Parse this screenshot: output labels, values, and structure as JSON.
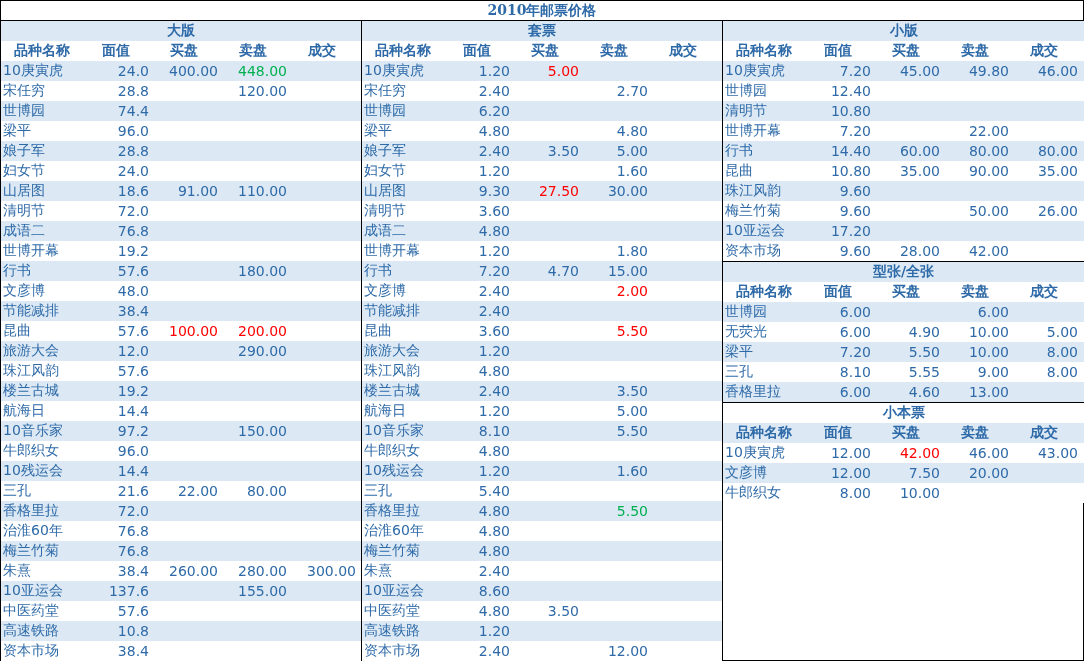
{
  "title": "2010年邮票价格",
  "panels": [
    {
      "sections": [
        {
          "title": "大版",
          "columns": [
            "品种名称",
            "面值",
            "买盘",
            "卖盘",
            "成交"
          ],
          "rows": [
            {
              "name": "10庚寅虎",
              "face": "24.0",
              "bid": "400.00",
              "ask": {
                "text": "448.00",
                "color": "#00b050"
              }
            },
            {
              "name": "宋任穷",
              "face": "28.8",
              "ask": "120.00"
            },
            {
              "name": "世博园",
              "face": "74.4"
            },
            {
              "name": "梁平",
              "face": "96.0"
            },
            {
              "name": "娘子军",
              "face": "28.8"
            },
            {
              "name": "妇女节",
              "face": "24.0"
            },
            {
              "name": "山居图",
              "face": "18.6",
              "bid": "91.00",
              "ask": "110.00"
            },
            {
              "name": "清明节",
              "face": "72.0"
            },
            {
              "name": "成语二",
              "face": "76.8"
            },
            {
              "name": "世博开幕",
              "face": "19.2"
            },
            {
              "name": "行书",
              "face": "57.6",
              "ask": "180.00"
            },
            {
              "name": "文彦博",
              "face": "48.0"
            },
            {
              "name": "节能减排",
              "face": "38.4"
            },
            {
              "name": "昆曲",
              "face": "57.6",
              "bid": {
                "text": "100.00",
                "color": "#ff0000"
              },
              "ask": {
                "text": "200.00",
                "color": "#ff0000"
              }
            },
            {
              "name": "旅游大会",
              "face": "12.0",
              "ask": "290.00"
            },
            {
              "name": "珠江风韵",
              "face": "57.6"
            },
            {
              "name": "楼兰古城",
              "face": "19.2"
            },
            {
              "name": "航海日",
              "face": "14.4"
            },
            {
              "name": "10音乐家",
              "face": "97.2",
              "ask": "150.00"
            },
            {
              "name": "牛郎织女",
              "face": "96.0"
            },
            {
              "name": "10残运会",
              "face": "14.4"
            },
            {
              "name": "三孔",
              "face": "21.6",
              "bid": "22.00",
              "ask": "80.00"
            },
            {
              "name": "香格里拉",
              "face": "72.0"
            },
            {
              "name": "治淮60年",
              "face": "76.8"
            },
            {
              "name": "梅兰竹菊",
              "face": "76.8"
            },
            {
              "name": "朱熹",
              "face": "38.4",
              "bid": "260.00",
              "ask": "280.00",
              "deal": "300.00"
            },
            {
              "name": "10亚运会",
              "face": "137.6",
              "ask": "155.00"
            },
            {
              "name": "中医药堂",
              "face": "57.6"
            },
            {
              "name": "高速铁路",
              "face": "10.8"
            },
            {
              "name": "资本市场",
              "face": "38.4"
            }
          ]
        }
      ]
    },
    {
      "sections": [
        {
          "title": "套票",
          "columns": [
            "品种名称",
            "面值",
            "买盘",
            "卖盘",
            "成交"
          ],
          "rows": [
            {
              "name": "10庚寅虎",
              "face": "1.20",
              "bid": {
                "text": "5.00",
                "color": "#ff0000"
              }
            },
            {
              "name": "宋任穷",
              "face": "2.40",
              "ask": "2.70"
            },
            {
              "name": "世博园",
              "face": "6.20"
            },
            {
              "name": "梁平",
              "face": "4.80",
              "ask": "4.80"
            },
            {
              "name": "娘子军",
              "face": "2.40",
              "bid": "3.50",
              "ask": "5.00"
            },
            {
              "name": "妇女节",
              "face": "1.20",
              "ask": "1.60"
            },
            {
              "name": "山居图",
              "face": "9.30",
              "bid": {
                "text": "27.50",
                "color": "#ff0000"
              },
              "ask": "30.00"
            },
            {
              "name": "清明节",
              "face": "3.60"
            },
            {
              "name": "成语二",
              "face": "4.80"
            },
            {
              "name": "世博开幕",
              "face": "1.20",
              "ask": "1.80"
            },
            {
              "name": "行书",
              "face": "7.20",
              "bid": "4.70",
              "ask": "15.00"
            },
            {
              "name": "文彦博",
              "face": "2.40",
              "ask": {
                "text": "2.00",
                "color": "#ff0000"
              }
            },
            {
              "name": "节能减排",
              "face": "2.40"
            },
            {
              "name": "昆曲",
              "face": "3.60",
              "ask": {
                "text": "5.50",
                "color": "#ff0000"
              }
            },
            {
              "name": "旅游大会",
              "face": "1.20"
            },
            {
              "name": "珠江风韵",
              "face": "4.80"
            },
            {
              "name": "楼兰古城",
              "face": "2.40",
              "ask": "3.50"
            },
            {
              "name": "航海日",
              "face": "1.20",
              "ask": "5.00"
            },
            {
              "name": "10音乐家",
              "face": "8.10",
              "ask": "5.50"
            },
            {
              "name": "牛郎织女",
              "face": "4.80"
            },
            {
              "name": "10残运会",
              "face": "1.20",
              "ask": "1.60"
            },
            {
              "name": "三孔",
              "face": "5.40"
            },
            {
              "name": "香格里拉",
              "face": "4.80",
              "ask": {
                "text": "5.50",
                "color": "#00b050"
              }
            },
            {
              "name": "治淮60年",
              "face": "4.80"
            },
            {
              "name": "梅兰竹菊",
              "face": "4.80"
            },
            {
              "name": "朱熹",
              "face": "2.40"
            },
            {
              "name": "10亚运会",
              "face": "8.60"
            },
            {
              "name": "中医药堂",
              "face": "4.80",
              "bid": "3.50"
            },
            {
              "name": "高速铁路",
              "face": "1.20"
            },
            {
              "name": "资本市场",
              "face": "2.40",
              "ask": "12.00"
            }
          ]
        }
      ]
    },
    {
      "sections": [
        {
          "title": "小版",
          "columns": [
            "品种名称",
            "面值",
            "买盘",
            "卖盘",
            "成交"
          ],
          "rows": [
            {
              "name": "10庚寅虎",
              "face": "7.20",
              "bid": "45.00",
              "ask": "49.80",
              "deal": "46.00"
            },
            {
              "name": "世博园",
              "face": "12.40"
            },
            {
              "name": "清明节",
              "face": "10.80"
            },
            {
              "name": "世博开幕",
              "face": "7.20",
              "ask": "22.00"
            },
            {
              "name": "行书",
              "face": "14.40",
              "bid": "60.00",
              "ask": "80.00",
              "deal": "80.00"
            },
            {
              "name": "昆曲",
              "face": "10.80",
              "bid": "35.00",
              "ask": "90.00",
              "deal": "35.00"
            },
            {
              "name": "珠江风韵",
              "face": "9.60"
            },
            {
              "name": "梅兰竹菊",
              "face": "9.60",
              "ask": "50.00",
              "deal": "26.00"
            },
            {
              "name": "10亚运会",
              "face": "17.20"
            },
            {
              "name": "资本市场",
              "face": "9.60",
              "bid": "28.00",
              "ask": "42.00"
            }
          ]
        },
        {
          "title": "型张/全张",
          "columns": [
            "品种名称",
            "面值",
            "买盘",
            "卖盘",
            "成交"
          ],
          "rows": [
            {
              "name": "世博园",
              "face": "6.00",
              "ask": "6.00"
            },
            {
              "name": "无荧光",
              "face": "6.00",
              "bid": "4.90",
              "ask": "10.00",
              "deal": "5.00"
            },
            {
              "name": "梁平",
              "face": "7.20",
              "bid": "5.50",
              "ask": "10.00",
              "deal": "8.00"
            },
            {
              "name": "三孔",
              "face": "8.10",
              "bid": "5.55",
              "ask": "9.00",
              "deal": "8.00"
            },
            {
              "name": "香格里拉",
              "face": "6.00",
              "bid": "4.60",
              "ask": "13.00"
            }
          ]
        },
        {
          "title": "小本票",
          "columns": [
            "品种名称",
            "面值",
            "买盘",
            "卖盘",
            "成交"
          ],
          "rows": [
            {
              "name": "10庚寅虎",
              "face": "12.00",
              "bid": {
                "text": "42.00",
                "color": "#ff0000"
              },
              "ask": "46.00",
              "deal": "43.00"
            },
            {
              "name": "文彦博",
              "face": "12.00",
              "bid": "7.50",
              "ask": "20.00"
            },
            {
              "name": "牛郎织女",
              "face": "8.00",
              "bid": "10.00"
            }
          ]
        }
      ]
    }
  ]
}
